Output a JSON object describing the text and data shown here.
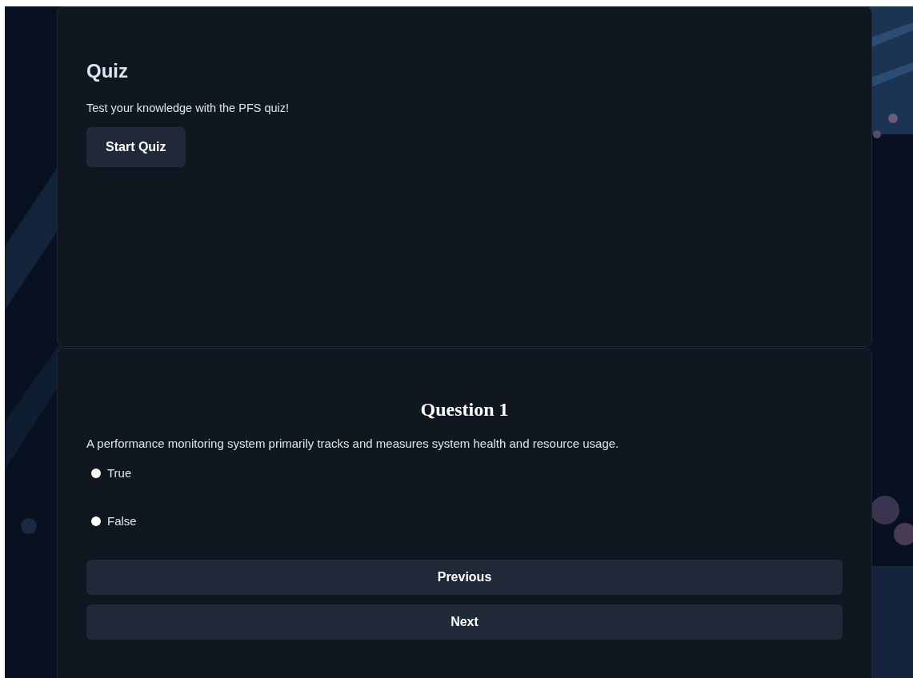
{
  "intro": {
    "title": "Quiz",
    "text": "Test your knowledge with the PFS quiz!",
    "start_button": "Start Quiz"
  },
  "question": {
    "title": "Question 1",
    "text": "A performance monitoring system primarily tracks and measures system health and resource usage.",
    "options": [
      {
        "label": "True",
        "selected": false
      },
      {
        "label": "False",
        "selected": false
      }
    ],
    "buttons": [
      "Previous",
      "Next"
    ]
  }
}
